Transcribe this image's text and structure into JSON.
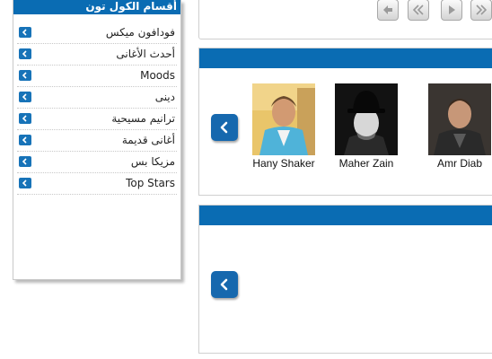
{
  "sidebar": {
    "title": "أقسام الكول تون",
    "items": [
      {
        "label": "فودافون ميكس"
      },
      {
        "label": "أحدث الأغانى"
      },
      {
        "label": "Moods"
      },
      {
        "label": "دينى"
      },
      {
        "label": "ترانيم مسيحية"
      },
      {
        "label": "أغانى قديمة"
      },
      {
        "label": "مزيكا بس"
      },
      {
        "label": "Top Stars"
      }
    ]
  },
  "pager": {
    "buttons": [
      "arrow-left-icon",
      "double-chevron-left-icon",
      "play-right-icon",
      "double-chevron-right-icon"
    ]
  },
  "panels": [
    {
      "artists": [
        {
          "name": "Hany Shaker"
        },
        {
          "name": "Maher Zain"
        },
        {
          "name": "Amr Diab"
        }
      ]
    },
    {
      "artists": []
    }
  ],
  "colors": {
    "accent": "#0a6cb3",
    "button": "#1668ae",
    "border": "#cfcfcf"
  }
}
